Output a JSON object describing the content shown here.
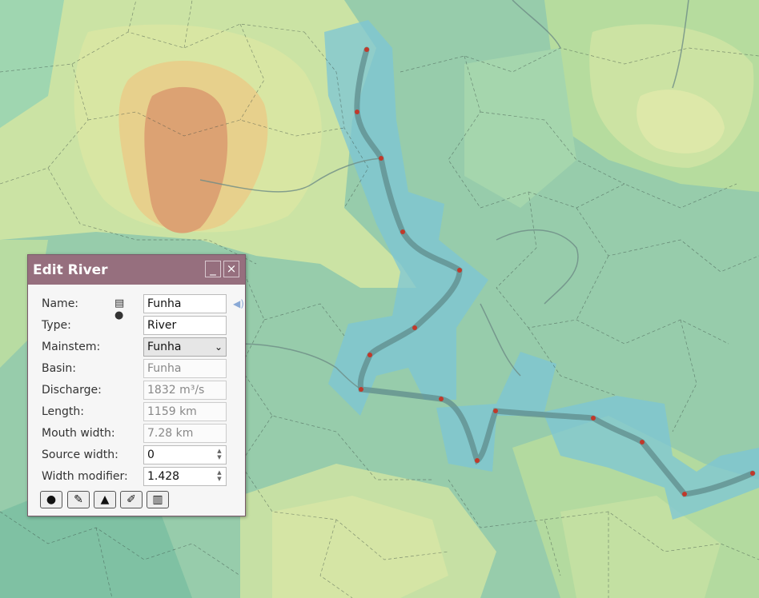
{
  "dialog": {
    "title": "Edit River",
    "minimize_label": "_",
    "close_label": "×"
  },
  "fields": {
    "name": {
      "label": "Name:",
      "value": "Funha"
    },
    "type": {
      "label": "Type:",
      "value": "River"
    },
    "mainstem": {
      "label": "Mainstem:",
      "value": "Funha"
    },
    "basin": {
      "label": "Basin:",
      "value": "Funha"
    },
    "discharge": {
      "label": "Discharge:",
      "value": "1832 m³/s"
    },
    "length": {
      "label": "Length:",
      "value": "1159 km"
    },
    "mouth_width": {
      "label": "Mouth width:",
      "value": "7.28 km"
    },
    "source_width": {
      "label": "Source width:",
      "value": "0"
    },
    "width_modifier": {
      "label": "Width modifier:",
      "value": "1.428"
    }
  },
  "icons": {
    "name_icons": [
      "book-icon",
      "globe-icon",
      "speaker-icon"
    ],
    "toolbar": [
      "pin-icon",
      "brush-icon",
      "elevation-profile-icon",
      "edit-icon",
      "trash-icon"
    ]
  },
  "colors": {
    "titlebar": "#966f7e",
    "river_highlight": "#7cc6d6",
    "river_line": "#5f8c8c",
    "control_point": "#c0392b"
  }
}
